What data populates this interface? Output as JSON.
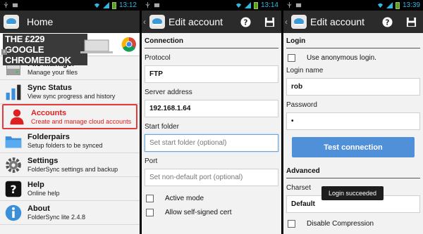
{
  "screens": [
    {
      "time": "13:12",
      "title": "Home",
      "ad": {
        "text": "THE £229 GOOGLE CHROMEBOOK"
      },
      "menu": [
        {
          "id": "file-manager",
          "title": "File Manager",
          "subtitle": "Manage your files",
          "icon": "folder-drive-icon"
        },
        {
          "id": "sync-status",
          "title": "Sync Status",
          "subtitle": "View sync progress and history",
          "icon": "bar-chart-icon"
        },
        {
          "id": "accounts",
          "title": "Accounts",
          "subtitle": "Create and manage cloud accounts",
          "icon": "person-icon",
          "selected": true
        },
        {
          "id": "folderpairs",
          "title": "Folderpairs",
          "subtitle": "Setup folders to be synced",
          "icon": "folder-icon"
        },
        {
          "id": "settings",
          "title": "Settings",
          "subtitle": "FolderSync settings and backup",
          "icon": "gear-icon"
        },
        {
          "id": "help",
          "title": "Help",
          "subtitle": "Online help",
          "icon": "question-icon"
        },
        {
          "id": "about",
          "title": "About",
          "subtitle": "FolderSync lite 2.4.8",
          "icon": "info-icon"
        }
      ]
    },
    {
      "time": "13:14",
      "title": "Edit account",
      "section": "Connection",
      "protocol_label": "Protocol",
      "protocol_value": "FTP",
      "server_label": "Server address",
      "server_value": "192.168.1.64",
      "start_folder_label": "Start folder",
      "start_folder_placeholder": "Set start folder (optional)",
      "port_label": "Port",
      "port_placeholder": "Set non-default port (optional)",
      "active_mode_label": "Active mode",
      "self_signed_label": "Allow self-signed cert"
    },
    {
      "time": "13:39",
      "title": "Edit account",
      "section": "Login",
      "anon_label": "Use anonymous login.",
      "login_label": "Login name",
      "login_value": "rob",
      "password_label": "Password",
      "password_value": "•",
      "test_button": "Test connection",
      "advanced_section": "Advanced",
      "charset_label": "Charset",
      "charset_value": "Default",
      "disable_compression_label": "Disable Compression",
      "toast": "Login succeeded"
    }
  ],
  "colors": {
    "accent": "#33b5e5",
    "selected": "#e02020",
    "button": "#4f90d9"
  }
}
